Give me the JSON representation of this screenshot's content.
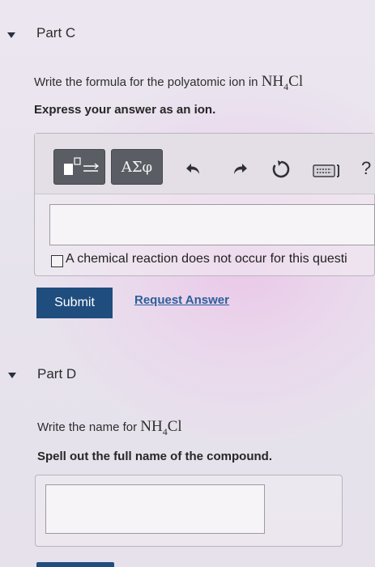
{
  "partC": {
    "title": "Part C",
    "prompt_text": "Write the formula for the polyatomic ion in",
    "formula_main": "NH",
    "formula_sub": "4",
    "formula_tail": "Cl",
    "instruction": "Express your answer as an ion.",
    "toolbar": {
      "greek_label": "ΑΣφ",
      "help_label": "?"
    },
    "checkbox_label": "A chemical reaction does not occur for this questi",
    "submit_label": "Submit",
    "request_label": "Request Answer"
  },
  "partD": {
    "title": "Part D",
    "prompt_text": "Write the name for",
    "formula_main": "NH",
    "formula_sub": "4",
    "formula_tail": "Cl",
    "instruction": "Spell out the full name of the compound."
  },
  "colors": {
    "submit_bg": "#1f4d7e",
    "link": "#2b5f9b",
    "toolbar_button": "#5a5d63"
  },
  "icons": [
    "collapse-caret-icon",
    "template-icon",
    "undo-icon",
    "redo-icon",
    "reset-icon",
    "keyboard-icon",
    "help-icon"
  ]
}
